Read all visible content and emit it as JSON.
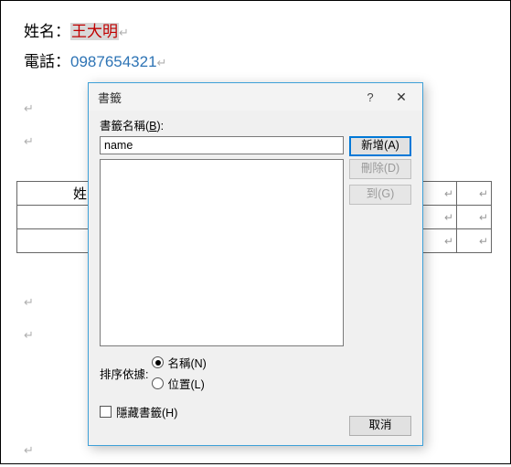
{
  "doc": {
    "name_label": "姓名：",
    "name_value": "王大明",
    "phone_label": "電話：",
    "phone_value": "0987654321",
    "para_mark": "↵",
    "bg_cell_header": "姓"
  },
  "dialog": {
    "title": "書籤",
    "help": "?",
    "close": "✕",
    "name_label_pre": "書籤名稱(",
    "name_label_u": "B",
    "name_label_post": "):",
    "name_value": "name",
    "buttons": {
      "add": "新增(A)",
      "delete": "刪除(D)",
      "goto": "到(G)",
      "cancel": "取消"
    },
    "sort_label": "排序依據:",
    "sort_name": "名稱(N)",
    "sort_loc": "位置(L)",
    "hide_label": "隱藏書籤(H)"
  }
}
